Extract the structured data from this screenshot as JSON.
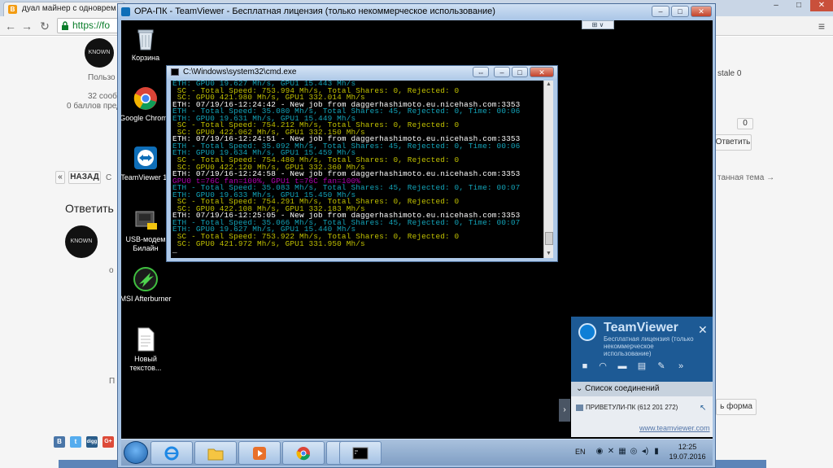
{
  "browser": {
    "tab_title": "дуал майнер с одноврем",
    "url_scheme": "https://fo",
    "page": {
      "user_label": "Пользо",
      "posts_count": "32 сооб",
      "points": "0 баллов пред",
      "right_user": "stale 0",
      "reply_count": "0",
      "reply_btn": "Ответить",
      "back_btn": "НАЗАД",
      "prev_link": "С",
      "next_topic": "танная тема →",
      "reply_heading": "Ответить",
      "form_btn": "ь форма",
      "paragraph_mark": "П",
      "avatar_text": "KNOWN"
    },
    "share_labels": [
      "В",
      "t",
      "digg",
      "G+"
    ]
  },
  "teamviewer": {
    "title": "ОРА-ПК - TeamViewer - Бесплатная лицензия (только некоммерческое использование)",
    "popup": {
      "brand": "TeamViewer",
      "license": "Бесплатная лицензия (только некоммерческое использование)",
      "list_header": "Список соединений",
      "entry": "ПРИВЕТУЛИ-ПК (612 201 272)",
      "site": "www.teamviewer.com"
    }
  },
  "desktop_icons": [
    {
      "label": "Корзина",
      "icon": "recycle-bin-icon"
    },
    {
      "label": "Google Chrome",
      "icon": "chrome-icon"
    },
    {
      "label": "TeamViewer 11",
      "icon": "teamviewer-icon"
    },
    {
      "label": "USB-модем Билайн",
      "icon": "usb-modem-icon"
    },
    {
      "label": "MSI Afterburner",
      "icon": "afterburner-icon"
    },
    {
      "label": "Новый текстов...",
      "icon": "text-file-icon"
    }
  ],
  "cmd": {
    "title": "C:\\Windows\\system32\\cmd.exe",
    "colors": {
      "eth": "#ffffff",
      "cyan": "#13a3b8",
      "yellow": "#c0c000",
      "magenta": "#b000b0"
    },
    "lines": [
      {
        "c": "cyan",
        "t": "ETH: GPU0 19.627 Mh/s, GPU1 15.443 Mh/s"
      },
      {
        "c": "yellow",
        "t": " SC - Total Speed: 753.994 Mh/s, Total Shares: 0, Rejected: 0"
      },
      {
        "c": "yellow",
        "t": " SC: GPU0 421.980 Mh/s, GPU1 332.014 Mh/s"
      },
      {
        "c": "eth",
        "t": "ETH: 07/19/16-12:24:42 - New job from daggerhashimoto.eu.nicehash.com:3353"
      },
      {
        "c": "cyan",
        "t": "ETH - Total Speed: 35.080 Mh/s, Total Shares: 45, Rejected: 0, Time: 00:06"
      },
      {
        "c": "cyan",
        "t": "ETH: GPU0 19.631 Mh/s, GPU1 15.449 Mh/s"
      },
      {
        "c": "yellow",
        "t": " SC - Total Speed: 754.212 Mh/s, Total Shares: 0, Rejected: 0"
      },
      {
        "c": "yellow",
        "t": " SC: GPU0 422.062 Mh/s, GPU1 332.150 Mh/s"
      },
      {
        "c": "eth",
        "t": "ETH: 07/19/16-12:24:51 - New job from daggerhashimoto.eu.nicehash.com:3353"
      },
      {
        "c": "cyan",
        "t": "ETH - Total Speed: 35.092 Mh/s, Total Shares: 45, Rejected: 0, Time: 00:06"
      },
      {
        "c": "cyan",
        "t": "ETH: GPU0 19.634 Mh/s, GPU1 15.459 Mh/s"
      },
      {
        "c": "yellow",
        "t": " SC - Total Speed: 754.480 Mh/s, Total Shares: 0, Rejected: 0"
      },
      {
        "c": "yellow",
        "t": " SC: GPU0 422.120 Mh/s, GPU1 332.360 Mh/s"
      },
      {
        "c": "eth",
        "t": "ETH: 07/19/16-12:24:58 - New job from daggerhashimoto.eu.nicehash.com:3353"
      },
      {
        "c": "magenta",
        "t": "GPU0 t=76C fan=100%, GPU1 t=76C fan=100%"
      },
      {
        "c": "cyan",
        "t": "ETH - Total Speed: 35.083 Mh/s, Total Shares: 45, Rejected: 0, Time: 00:07"
      },
      {
        "c": "cyan",
        "t": "ETH: GPU0 19.633 Mh/s, GPU1 15.450 Mh/s"
      },
      {
        "c": "yellow",
        "t": " SC - Total Speed: 754.291 Mh/s, Total Shares: 0, Rejected: 0"
      },
      {
        "c": "yellow",
        "t": " SC: GPU0 422.108 Mh/s, GPU1 332.183 Mh/s"
      },
      {
        "c": "eth",
        "t": "ETH: 07/19/16-12:25:05 - New job from daggerhashimoto.eu.nicehash.com:3353"
      },
      {
        "c": "cyan",
        "t": "ETH - Total Speed: 35.066 Mh/s, Total Shares: 45, Rejected: 0, Time: 00:07"
      },
      {
        "c": "cyan",
        "t": "ETH: GPU0 19.627 Mh/s, GPU1 15.440 Mh/s"
      },
      {
        "c": "yellow",
        "t": " SC - Total Speed: 753.922 Mh/s, Total Shares: 0, Rejected: 0"
      },
      {
        "c": "yellow",
        "t": " SC: GPU0 421.972 Mh/s, GPU1 331.950 Mh/s"
      },
      {
        "c": "eth",
        "t": "_"
      }
    ]
  },
  "taskbar": {
    "lang": "EN",
    "time": "12:25",
    "date": "19.07.2016"
  }
}
